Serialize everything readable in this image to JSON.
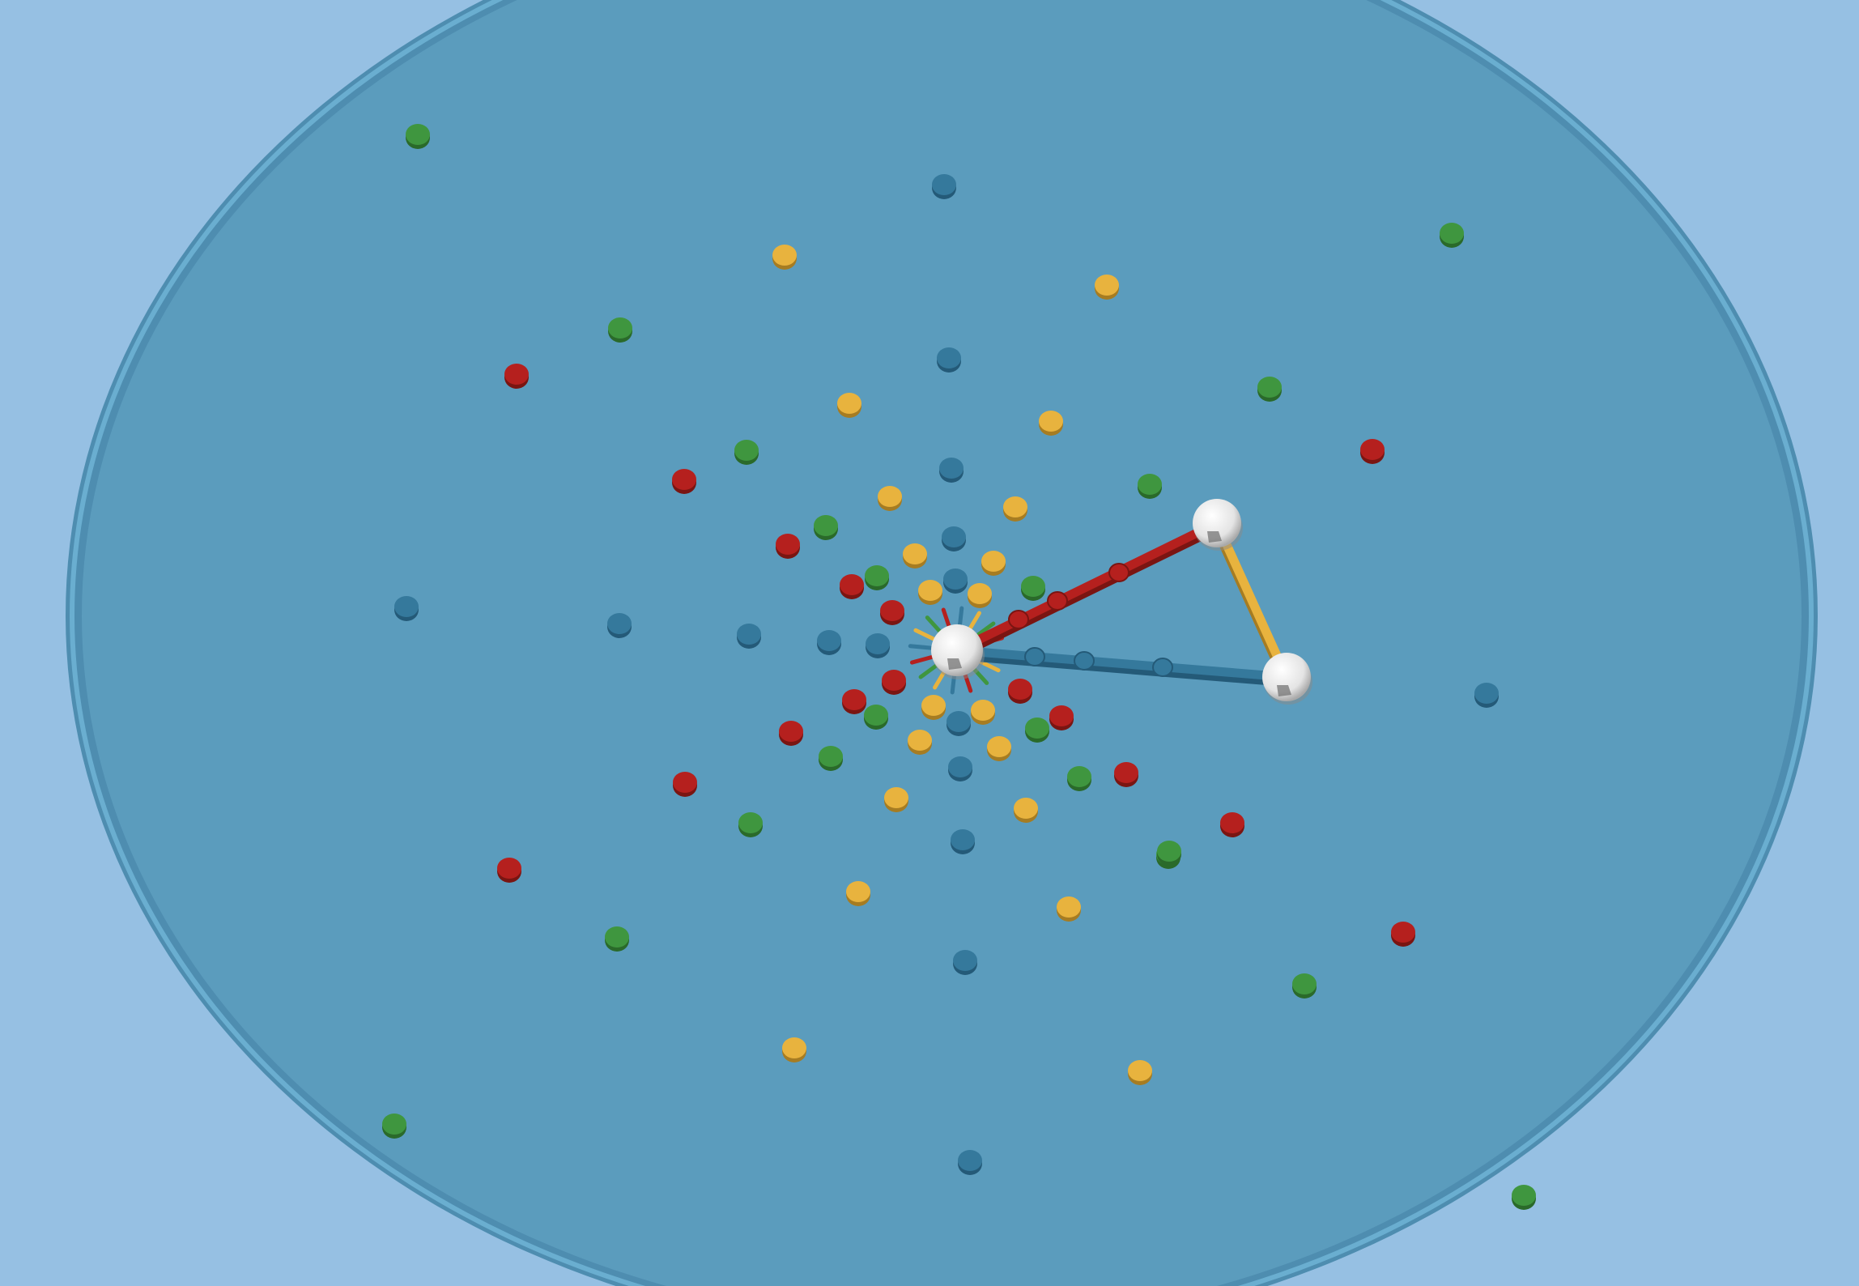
{
  "scene": {
    "colors": {
      "sky": "#96c0e3",
      "board": "#5b9cbd",
      "board_rim": "#4e8db0",
      "red": "#b5201e",
      "green": "#3f963f",
      "yellow": "#e8b33e",
      "blue": "#35799c",
      "node": "#f2f2f2"
    },
    "peg_colors": [
      "red",
      "green",
      "yellow",
      "blue"
    ],
    "hub": {
      "label": "hub-node"
    },
    "nodes": [
      "node-a",
      "node-b"
    ],
    "rods": [
      {
        "name": "red-rod",
        "color": "red",
        "from": "hub",
        "to": "node-a"
      },
      {
        "name": "yellow-rod",
        "color": "yellow",
        "from": "node-a",
        "to": "node-b"
      },
      {
        "name": "blue-rod",
        "color": "blue",
        "from": "hub",
        "to": "node-b"
      }
    ]
  }
}
